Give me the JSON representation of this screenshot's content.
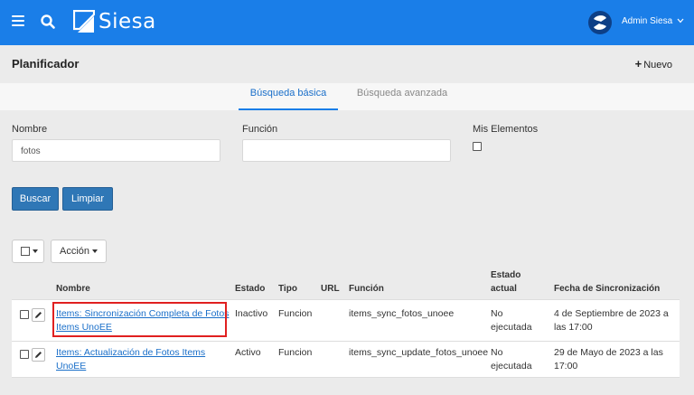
{
  "header": {
    "logo_text": "Siesa",
    "user": "Admin Siesa",
    "colors": {
      "bar": "#1a7ee8"
    }
  },
  "page": {
    "title": "Planificador",
    "new_label": "Nuevo"
  },
  "tabs": [
    {
      "label": "Búsqueda básica",
      "active": true
    },
    {
      "label": "Búsqueda avanzada",
      "active": false
    }
  ],
  "filters": {
    "nombre_label": "Nombre",
    "nombre_value": "fotos",
    "funcion_label": "Función",
    "funcion_value": "",
    "mis_elementos_label": "Mis Elementos"
  },
  "buttons": {
    "search": "Buscar",
    "clear": "Limpiar",
    "action": "Acción"
  },
  "table": {
    "headers": {
      "nombre": "Nombre",
      "estado": "Estado",
      "tipo": "Tipo",
      "url": "URL",
      "funcion": "Función",
      "estado_actual_1": "Estado",
      "estado_actual_2": "actual",
      "fecha": "Fecha de Sincronización"
    },
    "rows": [
      {
        "nombre_1": "Items: Sincronización Completa de Fotos",
        "nombre_2": "Items UnoEE",
        "estado": "Inactivo",
        "tipo": "Funcion",
        "url": "",
        "funcion": "items_sync_fotos_unoee",
        "estado_actual_1": "No",
        "estado_actual_2": "ejecutada",
        "fecha_1": "4 de Septiembre de 2023 a",
        "fecha_2": "las 17:00"
      },
      {
        "nombre_1": "Items: Actualización de Fotos Items",
        "nombre_2": "UnoEE",
        "estado": "Activo",
        "tipo": "Funcion",
        "url": "",
        "funcion": "items_sync_update_fotos_unoee",
        "estado_actual_1": "No",
        "estado_actual_2": "ejecutada",
        "fecha_1": "29 de Mayo de 2023 a las",
        "fecha_2": "17:00"
      }
    ]
  }
}
